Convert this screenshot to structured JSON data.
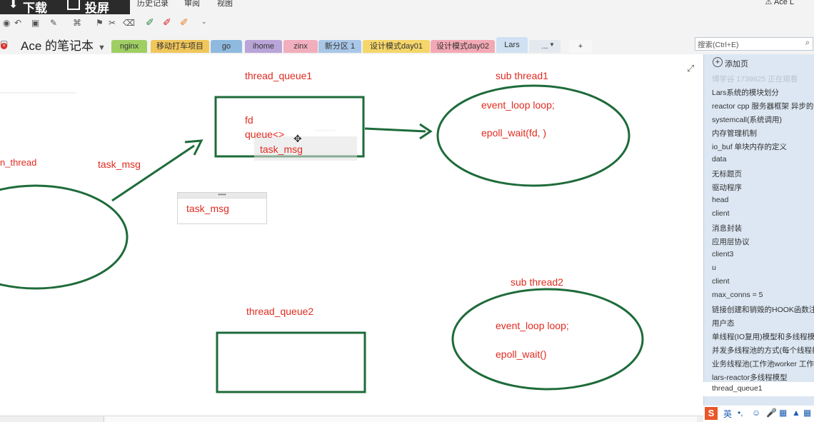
{
  "download_bar": {
    "download_label": "下载",
    "screen_label": "投屏"
  },
  "menu": {
    "history": "历史记录",
    "review": "审阅",
    "view": "视图"
  },
  "user": {
    "name": "Ace L"
  },
  "notebook": {
    "title": "Ace 的笔记本"
  },
  "tabs": [
    {
      "label": "nginx",
      "color": "#9fce63"
    },
    {
      "label": "移动打车项目",
      "color": "#f1c65a"
    },
    {
      "label": "go",
      "color": "#8fb9df"
    },
    {
      "label": "ihome",
      "color": "#b9a5d8"
    },
    {
      "label": "zinx",
      "color": "#f1aebd"
    },
    {
      "label": "新分区 1",
      "color": "#a9c7e8"
    },
    {
      "label": "设计模式day01",
      "color": "#f5d66a"
    },
    {
      "label": "设计模式day02",
      "color": "#f3a9b5"
    },
    {
      "label": "Lars",
      "color": "#cfe1f3"
    },
    {
      "label": "...",
      "color": "#e4e9ef"
    },
    {
      "label": "+",
      "color": "#f7f7f7"
    }
  ],
  "search": {
    "placeholder": "搜索(Ctrl+E)"
  },
  "canvas": {
    "thread_queue1": "thread_queue1",
    "fd": "fd",
    "queue": "queue<>",
    "task_msg_in_queue": "task_msg",
    "sub_thread1": "sub thread1",
    "event_loop1": "event_loop loop;",
    "epoll_wait1": "epoll_wait(fd, )",
    "main_thread": "n_thread",
    "task_msg_arrow": "task_msg",
    "task_msg_box": "task_msg",
    "thread_queue2": "thread_queue2",
    "sub_thread2": "sub thread2",
    "event_loop2": "event_loop loop;",
    "epoll_wait2": "epoll_wait()"
  },
  "pages": {
    "add_page": "添加页",
    "items": [
      "博学谷 1739825 正在观看",
      "Lars系统的模块划分",
      "reactor cpp 服务器框架 异步的",
      "systemcall(系统调用)",
      "内存管理机制",
      "io_buf 单块内存的定义",
      "data",
      "无标题页",
      "驱动程序",
      "head",
      "client",
      "消息封装",
      "应用层协议",
      "client3",
      "u",
      "client",
      "max_conns = 5",
      "链接创建和销毁的HOOK函数注",
      "用户态",
      "单线程(IO复用)模型和多线程模",
      "并发多线程池的方式(每个线程都",
      "业务线程池(工作池worker 工作",
      "lars-reactor多线程模型"
    ],
    "current": "thread_queue1"
  },
  "ime": {
    "label": "英"
  },
  "colors": {
    "label_red": "#e02b20",
    "shape_green": "#1e6b3a",
    "panel_blue": "#dce7f3"
  }
}
